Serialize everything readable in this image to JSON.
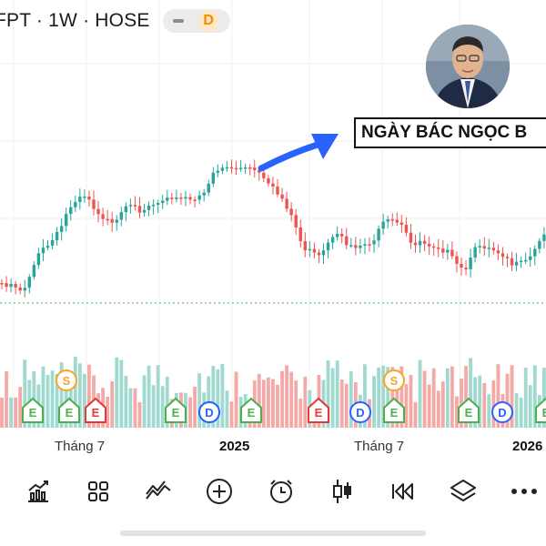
{
  "header": {
    "symbol": "FPT · 1W · HOSE",
    "interval_badge": "D"
  },
  "annotation": {
    "label": "NGÀY BÁC NGỌC B"
  },
  "x_axis": {
    "labels": [
      "Tháng 7",
      "2025",
      "Tháng 7",
      "2026"
    ]
  },
  "event_markers": [
    {
      "type": "E",
      "color": "#4caf50",
      "shape": "pentagon"
    },
    {
      "type": "E",
      "color": "#4caf50",
      "shape": "pentagon"
    },
    {
      "type": "S",
      "color": "#f5a623",
      "shape": "circle"
    },
    {
      "type": "E",
      "color": "#e53935",
      "shape": "pentagon"
    },
    {
      "type": "D",
      "color": "#2962ff",
      "shape": "circle"
    },
    {
      "type": "E",
      "color": "#4caf50",
      "shape": "pentagon"
    },
    {
      "type": "D",
      "color": "#2962ff",
      "shape": "circle"
    },
    {
      "type": "E",
      "color": "#4caf50",
      "shape": "pentagon"
    },
    {
      "type": "E",
      "color": "#e53935",
      "shape": "pentagon"
    },
    {
      "type": "D",
      "color": "#2962ff",
      "shape": "circle"
    },
    {
      "type": "E",
      "color": "#4caf50",
      "shape": "pentagon"
    },
    {
      "type": "S",
      "color": "#f5a623",
      "shape": "circle"
    },
    {
      "type": "E",
      "color": "#4caf50",
      "shape": "pentagon"
    },
    {
      "type": "D",
      "color": "#2962ff",
      "shape": "circle"
    },
    {
      "type": "E",
      "color": "#4caf50",
      "shape": "pentagon"
    }
  ],
  "toolbar": {
    "icons": [
      "indicators-icon",
      "layout-grid-icon",
      "drawing-tools-icon",
      "add-icon",
      "alert-clock-icon",
      "candle-type-icon",
      "replay-icon",
      "layers-icon",
      "more-icon"
    ]
  },
  "colors": {
    "up": "#26a69a",
    "down": "#ef5350",
    "arrow": "#2962ff",
    "earnings": "#4caf50",
    "dividend": "#2962ff",
    "split": "#f5a623"
  }
}
